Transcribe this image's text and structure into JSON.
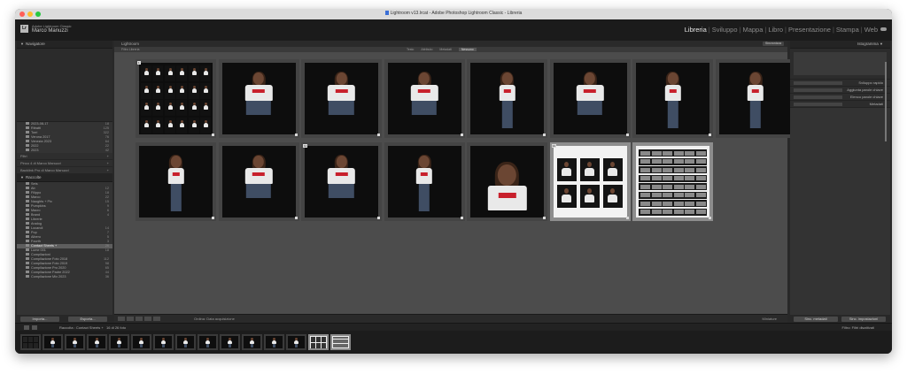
{
  "window": {
    "title": "Lightroom v13.lrcat - Adobe Photoshop Lightroom Classic - Libreria"
  },
  "identity": {
    "subtitle": "Adobe Lightroom Classic",
    "name": "Marco Manuzzi"
  },
  "modules": [
    "Libreria",
    "Sviluppo",
    "Mappa",
    "Libro",
    "Presentazione",
    "Stampa",
    "Web"
  ],
  "active_module": "Libreria",
  "left_panel": {
    "navigator_label": "Navigatore",
    "folders": [
      {
        "label": "2023-08-17",
        "count": "18"
      },
      {
        "label": "Ritratti",
        "count": "125"
      },
      {
        "label": "Torri",
        "count": "322"
      },
      {
        "label": "Verona 2017",
        "count": "76"
      },
      {
        "label": "Venezia 2023",
        "count": "64"
      },
      {
        "label": "2022",
        "count": "22"
      },
      {
        "label": "2023",
        "count": "42"
      }
    ],
    "sub_headers": [
      "Filtri",
      "Pinco 4 di Marco Manuzzi",
      "Backlink Pro di Marco Manuzzi"
    ],
    "collections_label": "Raccolte",
    "collections": [
      {
        "label": "Sets",
        "count": ""
      },
      {
        "label": "Ab",
        "count": "12"
      },
      {
        "label": "Filippo",
        "count": "18"
      },
      {
        "label": "Marco",
        "count": "22"
      },
      {
        "label": "Naughts + Pix",
        "count": "15"
      },
      {
        "label": "Pumpkins",
        "count": "9"
      },
      {
        "label": "Macro",
        "count": "6"
      },
      {
        "label": "Brand",
        "count": "4"
      },
      {
        "label": "Librerie",
        "count": ""
      },
      {
        "label": "Analog",
        "count": ""
      },
      {
        "label": "Locandi",
        "count": "14"
      },
      {
        "label": "Pop",
        "count": "7"
      },
      {
        "label": "Albero",
        "count": "5"
      },
      {
        "label": "Fourth",
        "count": "3"
      },
      {
        "label": "Contact Sheets +",
        "count": "26"
      },
      {
        "label": "Lume 001",
        "count": "18"
      },
      {
        "label": "Compilazioni",
        "count": ""
      },
      {
        "label": "Compilazione Foto 2018",
        "count": "112"
      },
      {
        "label": "Compilazione Foto 2019",
        "count": "98"
      },
      {
        "label": "Compilazione Pro 2020",
        "count": "65"
      },
      {
        "label": "Compilazione Padre 2022",
        "count": "44"
      },
      {
        "label": "Compilazione Mix 2023",
        "count": "36"
      }
    ],
    "selected_collection_index": 14,
    "import_button": "Importa...",
    "export_button": "Esporta..."
  },
  "center": {
    "header": "Lightroom",
    "header_button": "Sincronizza",
    "filter_left": "Filtro Libreria",
    "filter_options": [
      "Testo",
      "Attributo",
      "Metadati",
      "Nessuno"
    ],
    "filter_active": "Nessuno",
    "sort_label": "Ordina:",
    "sort_value": "Data acquisizione",
    "thumb_label": "Miniature"
  },
  "right_panel": {
    "histogram_label": "Istogramma",
    "rows": [
      "Sviluppo rapido",
      "Aggiunta parole chiave",
      "Elenco parole chiave",
      "Metadati"
    ],
    "sync_metadata": "Sinc. metadati",
    "sync_settings": "Sinc. impostazioni"
  },
  "filmstrip": {
    "path": "Raccolta : Contact Sheets +",
    "count_label": "16 di 26 foto",
    "filter_label": "Filtro:",
    "filter_value": "Filtri disattivati"
  },
  "thumbs": [
    {
      "type": "sheet"
    },
    {
      "type": "portrait",
      "pose": "sit"
    },
    {
      "type": "portrait",
      "pose": "sit"
    },
    {
      "type": "portrait",
      "pose": "sit"
    },
    {
      "type": "portrait",
      "pose": "stand"
    },
    {
      "type": "portrait",
      "pose": "sit"
    },
    {
      "type": "portrait",
      "pose": "stand"
    },
    {
      "type": "portrait",
      "pose": "stand"
    },
    {
      "type": "portrait",
      "pose": "stand"
    },
    {
      "type": "portrait",
      "pose": "sit"
    },
    {
      "type": "portrait",
      "pose": "sit"
    },
    {
      "type": "portrait",
      "pose": "stand"
    },
    {
      "type": "portrait",
      "pose": "close"
    },
    {
      "type": "contact"
    },
    {
      "type": "filmsheet"
    }
  ],
  "selected_cells": [
    13,
    14
  ],
  "cell_badges": {
    "0": "1",
    "10": "11",
    "13": "14"
  }
}
